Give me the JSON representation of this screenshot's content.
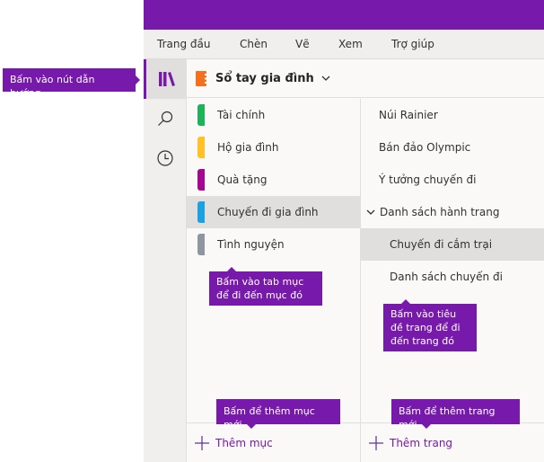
{
  "app": {
    "accent": "#7719aa"
  },
  "menu": {
    "items": [
      {
        "label": "Trang đầu"
      },
      {
        "label": "Chèn"
      },
      {
        "label": "Vẽ"
      },
      {
        "label": "Xem"
      },
      {
        "label": "Trợ giúp"
      }
    ]
  },
  "navrail": {
    "items": [
      {
        "icon": "notebooks-icon",
        "active": true
      },
      {
        "icon": "search-icon",
        "active": false
      },
      {
        "icon": "recent-clock-icon",
        "active": false
      }
    ]
  },
  "notebook": {
    "title": "Sổ tay gia đình",
    "color": "#f4701e"
  },
  "sections": [
    {
      "label": "Tài chính",
      "color": "#1fb25a",
      "selected": false
    },
    {
      "label": "Hộ gia đình",
      "color": "#ffc125",
      "selected": false
    },
    {
      "label": "Quà tặng",
      "color": "#a50890",
      "selected": false
    },
    {
      "label": "Chuyến đi gia đình",
      "color": "#1ba1e2",
      "selected": true
    },
    {
      "label": "Tình nguyện",
      "color": "#8e979f",
      "selected": false
    }
  ],
  "pages": [
    {
      "label": "Núi Rainier",
      "level": 0,
      "selected": false
    },
    {
      "label": "Bán đảo Olympic",
      "level": 0,
      "selected": false
    },
    {
      "label": "Ý tưởng chuyến đi",
      "level": 0,
      "selected": false
    },
    {
      "label": "Danh sách hành trang",
      "level": 0,
      "expanded": true,
      "selected": false
    },
    {
      "label": "Chuyến đi cắm trại",
      "level": 1,
      "selected": true
    },
    {
      "label": "Danh sách chuyến đi",
      "level": 1,
      "selected": false
    }
  ],
  "footer": {
    "add_section": "Thêm mục",
    "add_page": "Thêm trang"
  },
  "callouts": {
    "nav": "Bấm vào nút dẫn hướng",
    "section_tab": "Bấm vào tab mục để đi đến mục đó",
    "page_title": "Bấm vào tiêu đề trang để đi đến trang đó",
    "add_section": "Bấm để thêm mục mới",
    "add_page": "Bấm để thêm trang mới"
  }
}
